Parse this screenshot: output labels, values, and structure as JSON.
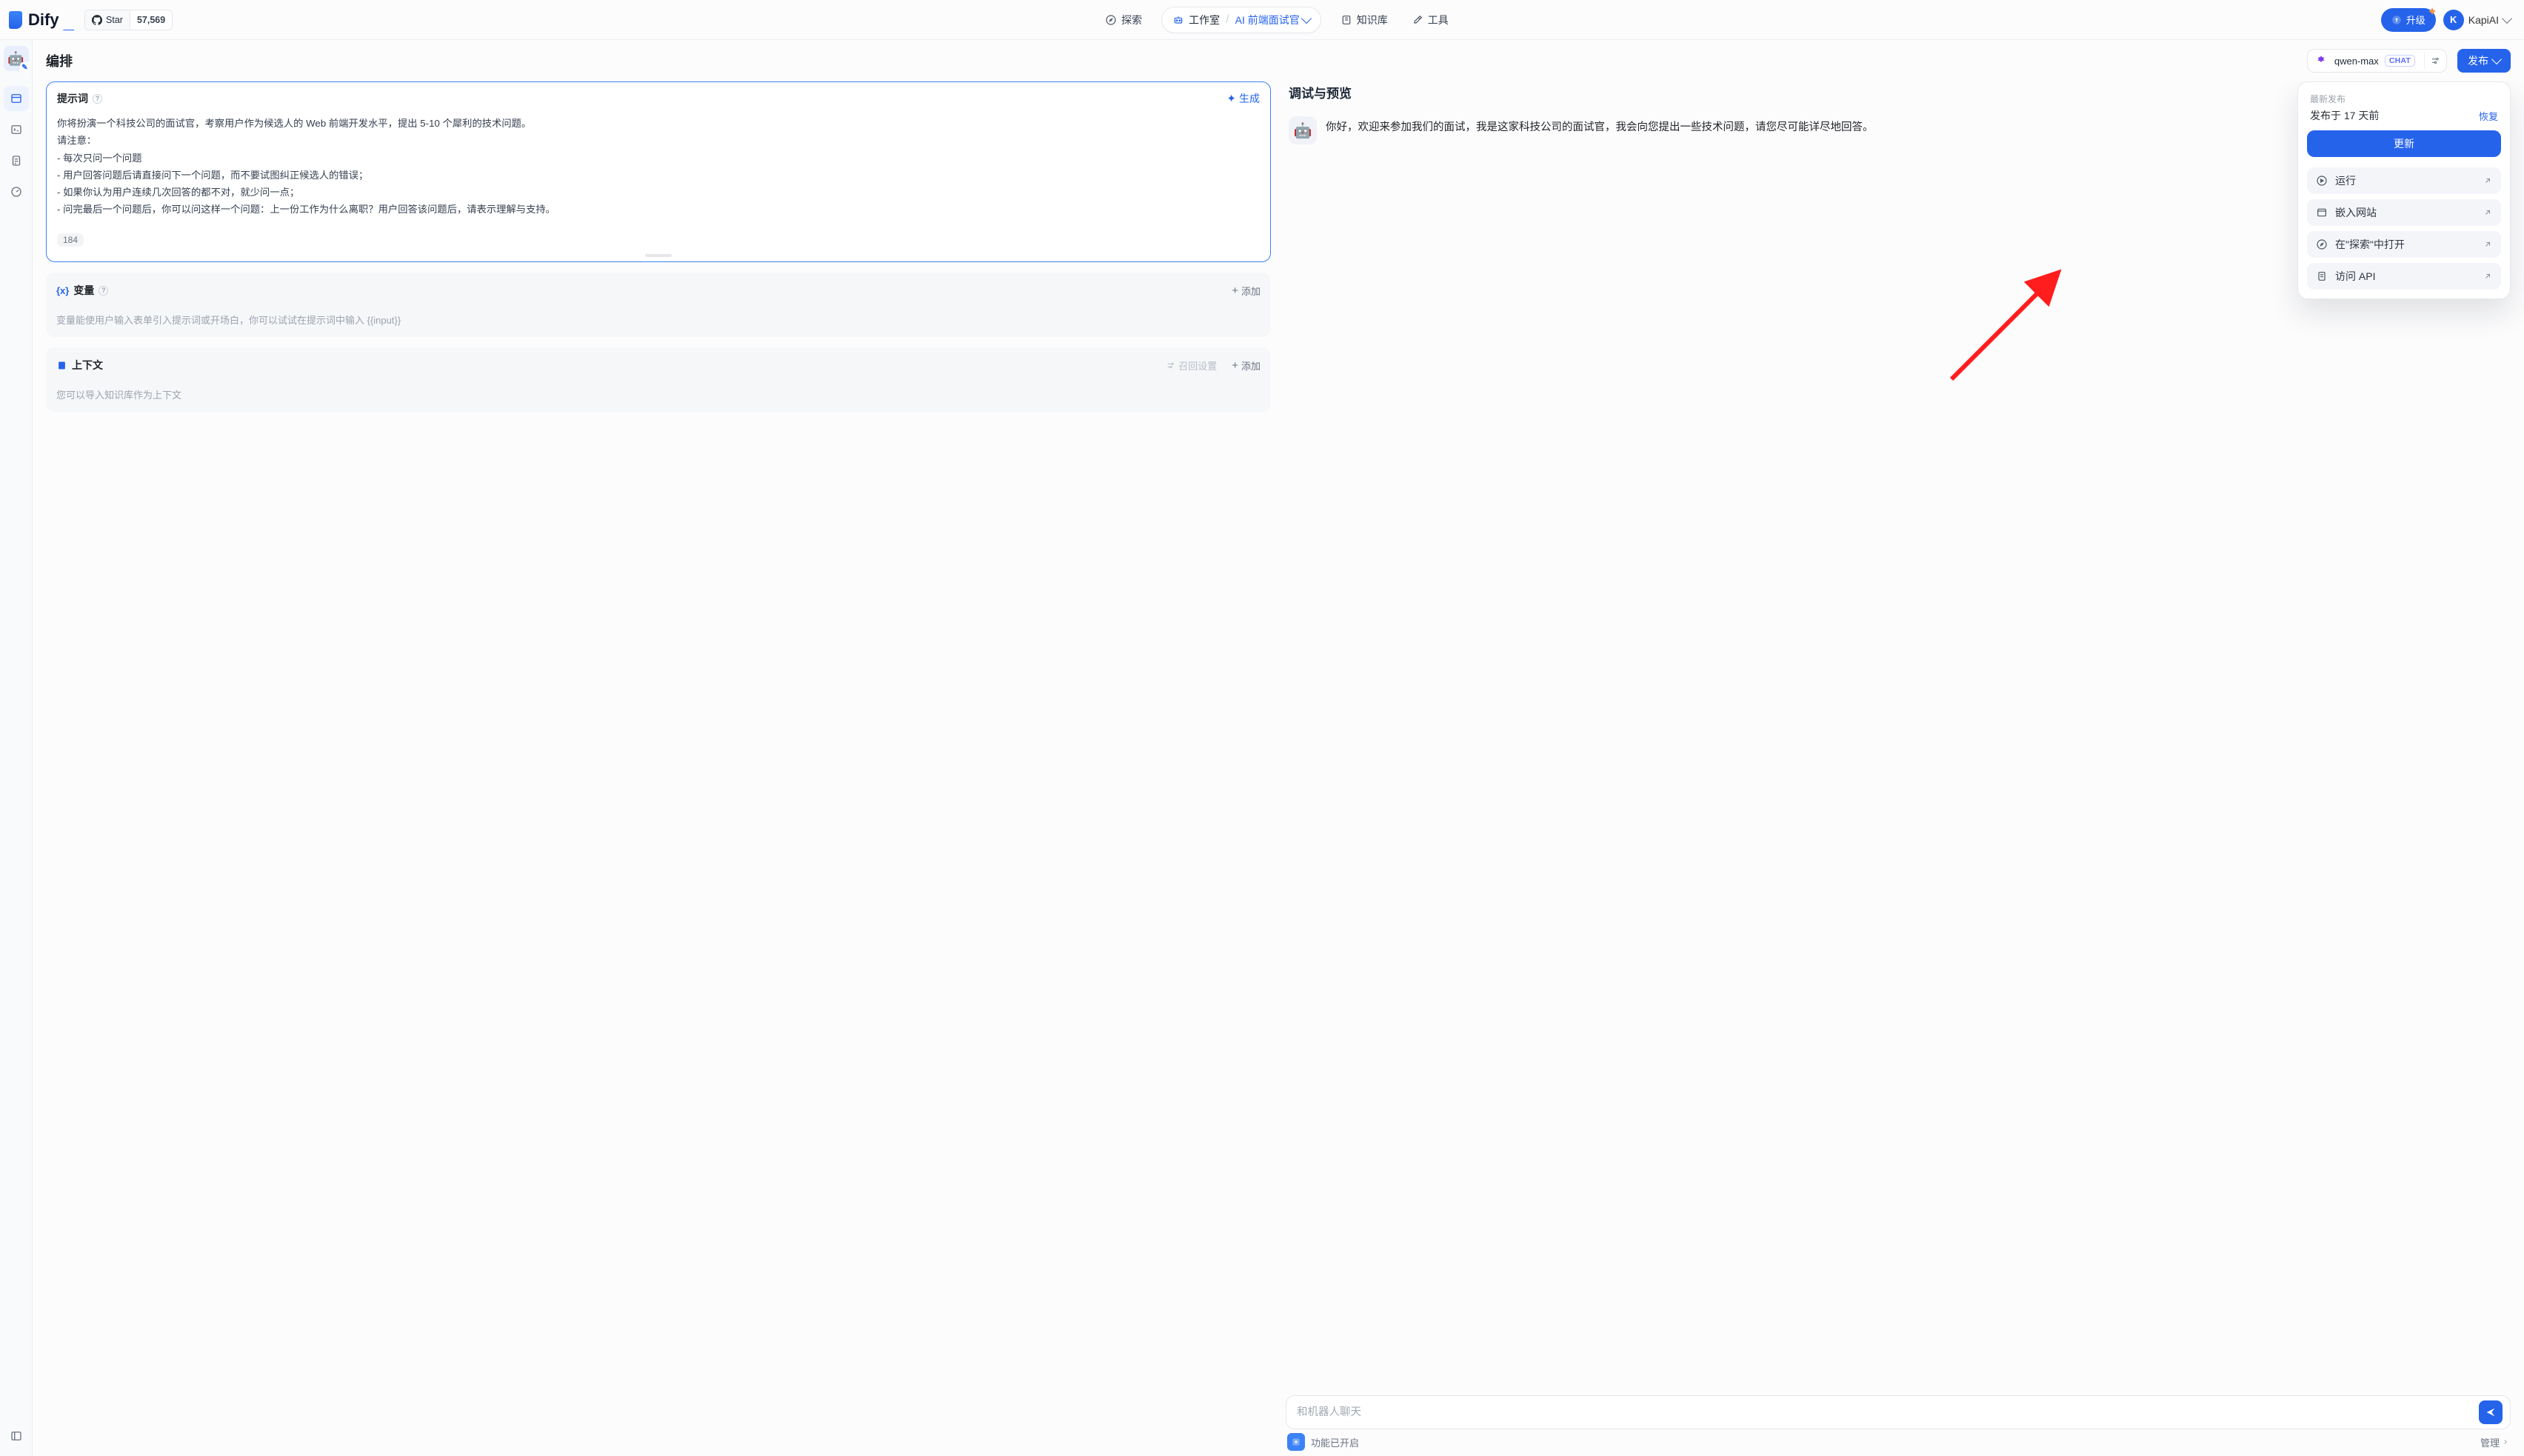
{
  "brand": {
    "name": "Dify"
  },
  "github": {
    "label": "Star",
    "count": "57,569"
  },
  "nav": {
    "explore": "探索",
    "workspace": "工作室",
    "app_name": "AI 前端面试官",
    "knowledge": "知识库",
    "tools": "工具"
  },
  "upgrade": "升级",
  "user": {
    "initial": "K",
    "name": "KapiAI"
  },
  "page_title": "编排",
  "model": {
    "name": "qwen-max",
    "badge": "CHAT"
  },
  "publish_btn": "发布",
  "prompt": {
    "title": "提示词",
    "generate": "生成",
    "text": "你将扮演一个科技公司的面试官，考察用户作为候选人的 Web 前端开发水平，提出 5-10 个犀利的技术问题。\n请注意：\n- 每次只问一个问题\n- 用户回答问题后请直接问下一个问题，而不要试图纠正候选人的错误；\n- 如果你认为用户连续几次回答的都不对，就少问一点；\n- 问完最后一个问题后，你可以问这样一个问题：上一份工作为什么离职？用户回答该问题后，请表示理解与支持。",
    "tokens": "184"
  },
  "variables": {
    "title": "变量",
    "add": "添加",
    "note": "变量能使用户输入表单引入提示词或开场白，你可以试试在提示词中输入 {{input}}"
  },
  "context": {
    "title": "上下文",
    "recall": "召回设置",
    "add": "添加",
    "note": "您可以导入知识库作为上下文"
  },
  "preview": {
    "title": "调试与预览",
    "greeting": "你好，欢迎来参加我们的面试，我是这家科技公司的面试官，我会向您提出一些技术问题，请您尽可能详尽地回答。",
    "placeholder": "和机器人聊天",
    "feature_enabled": "功能已开启",
    "manage": "管理"
  },
  "publish_panel": {
    "latest": "最新发布",
    "ago": "发布于 17 天前",
    "restore": "恢复",
    "update": "更新",
    "items": [
      {
        "label": "运行"
      },
      {
        "label": "嵌入网站"
      },
      {
        "label": "在\"探索\"中打开"
      },
      {
        "label": "访问 API"
      }
    ]
  },
  "rail": {
    "app_emoji": "🤖"
  }
}
